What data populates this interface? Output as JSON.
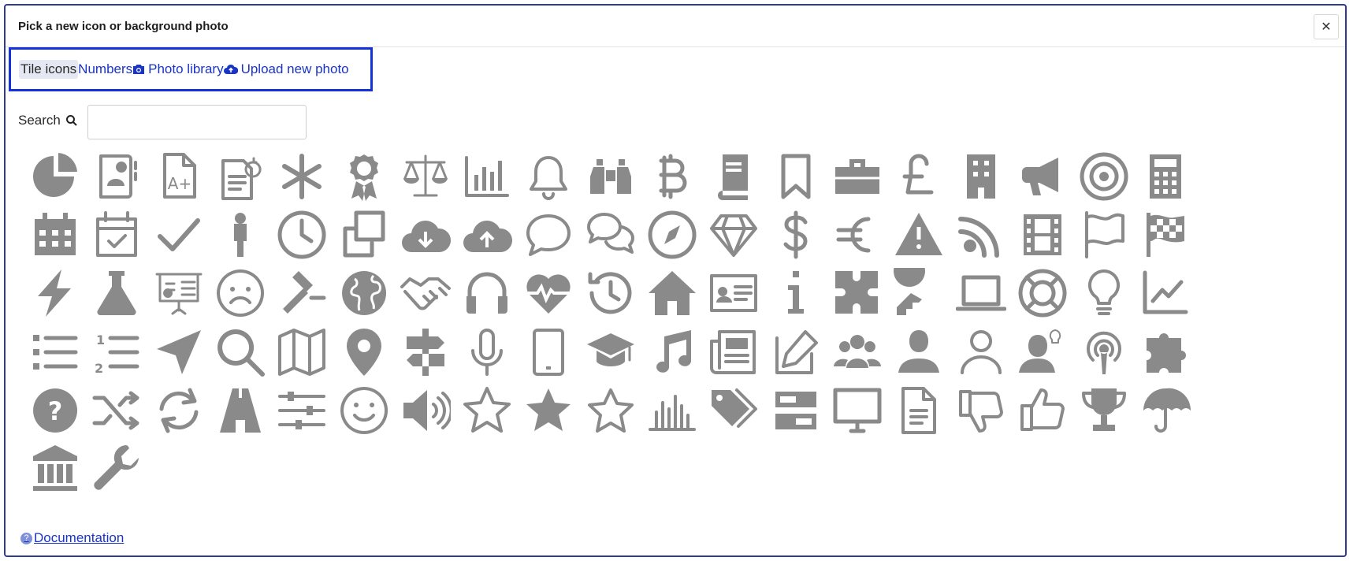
{
  "dialog": {
    "title": "Pick a new icon or background photo",
    "close_glyph": "✕"
  },
  "tabs": [
    {
      "label": "Tile icons",
      "icon": "",
      "active": true
    },
    {
      "label": "Numbers",
      "icon": "",
      "active": false
    },
    {
      "label": "Photo library",
      "icon": "camera-icon",
      "active": false
    },
    {
      "label": "Upload new photo",
      "icon": "cloud-upload-icon",
      "active": false
    }
  ],
  "search": {
    "label": "Search",
    "value": "",
    "placeholder": ""
  },
  "icons": [
    "pie-chart",
    "contact-card",
    "grade-file",
    "document-clock",
    "asterisk",
    "award-ribbon",
    "scales",
    "bar-chart",
    "bell",
    "binoculars",
    "bitcoin",
    "book",
    "bookmark",
    "briefcase",
    "pound",
    "building",
    "megaphone",
    "target",
    "calculator",
    "calendar",
    "calendar-check",
    "checkmark",
    "person",
    "clock",
    "copy",
    "cloud-download",
    "cloud-upload",
    "chat-bubble",
    "chat-bubbles",
    "compass",
    "diamond",
    "dollar",
    "euro",
    "warning",
    "rss",
    "film",
    "flag",
    "checkered-flag",
    "lightning",
    "flask",
    "presentation",
    "sad-face",
    "gavel",
    "globe",
    "handshake",
    "headphones",
    "heartbeat",
    "history",
    "home",
    "id-card",
    "info",
    "puzzle-pieces",
    "key",
    "laptop",
    "life-ring",
    "lightbulb",
    "line-chart",
    "list",
    "numbered-list",
    "location-arrow",
    "magnifier",
    "map",
    "map-pin",
    "signpost",
    "microphone",
    "mobile",
    "graduation-cap",
    "music",
    "newspaper",
    "edit",
    "users",
    "user-silhouette",
    "user-outline",
    "user-idea",
    "podcast",
    "puzzle",
    "question",
    "shuffle",
    "refresh",
    "road",
    "sliders",
    "smile",
    "volume",
    "star-half",
    "star",
    "star-outline",
    "column-chart",
    "tags",
    "server",
    "monitor",
    "file-text",
    "thumbs-down",
    "thumbs-up",
    "trophy",
    "umbrella",
    "bank",
    "wrench"
  ],
  "colors": {
    "icon": "#8a8a8a",
    "link": "#1a34c4",
    "focus_border": "#1232dc",
    "active_tab_bg": "#e4e8f2"
  },
  "footer": {
    "documentation_label": "Documentation",
    "help_glyph": "?"
  }
}
